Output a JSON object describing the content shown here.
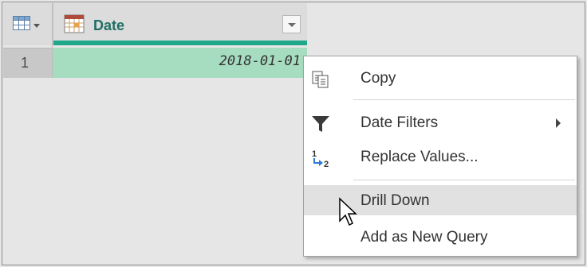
{
  "table": {
    "column": {
      "name": "Date",
      "type_icon": "calendar-icon",
      "filter_icon": "dropdown-arrow-icon"
    },
    "corner_icon": "table-grid-icon",
    "rows": [
      {
        "index": "1",
        "value": "2018-01-01"
      }
    ]
  },
  "context_menu": {
    "items": [
      {
        "label": "Copy",
        "icon": "copy-icon"
      },
      {
        "label": "Date Filters",
        "icon": "funnel-icon",
        "has_submenu": true
      },
      {
        "label": "Replace Values...",
        "icon": "replace-values-icon"
      },
      {
        "label": "Drill Down",
        "icon": "",
        "highlighted": true
      },
      {
        "label": "Add as New Query",
        "icon": ""
      }
    ]
  },
  "colors": {
    "accent_teal": "#1fa88a",
    "cell_green": "#a6dcbf",
    "menu_hover": "#e1e1e1"
  }
}
